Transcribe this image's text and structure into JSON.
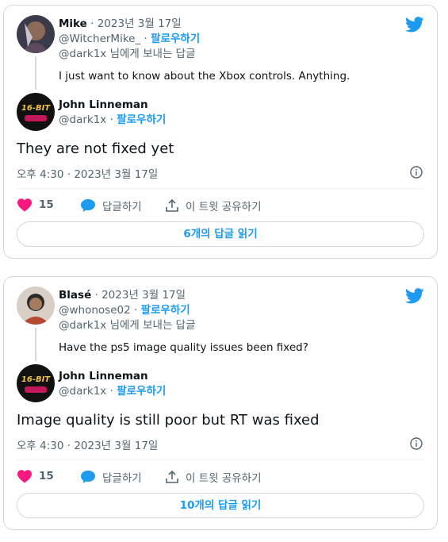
{
  "tweets": [
    {
      "parent": {
        "name": "Mike",
        "date": "· 2023년 3월 17일",
        "handle": "@WitcherMike_",
        "dot": "·",
        "follow": "팔로우하기",
        "reply_to": "@dark1x 님에게 보내는 답글",
        "text": "I just want to know about the Xbox controls. Anything."
      },
      "reply": {
        "name": "John Linneman",
        "handle": "@dark1x",
        "dot": "·",
        "follow": "팔로우하기",
        "avatar_text": "16-BIT",
        "text": "They are not fixed yet",
        "time": "오후 4:30 · 2023년 3월 17일"
      },
      "likes": "15",
      "reply_label": "답글하기",
      "share_label": "이 트윗 공유하기",
      "read_replies": "6개의 답글 읽기"
    },
    {
      "parent": {
        "name": "Blasé",
        "date": "· 2023년 3월 17일",
        "handle": "@whonose02",
        "dot": "·",
        "follow": "팔로우하기",
        "reply_to": "@dark1x 님에게 보내는 답글",
        "text": "Have the ps5 image quality issues been fixed?"
      },
      "reply": {
        "name": "John Linneman",
        "handle": "@dark1x",
        "dot": "·",
        "follow": "팔로우하기",
        "avatar_text": "16-BIT",
        "text": "Image quality is still poor but RT was fixed",
        "time": "오후 4:30 · 2023년 3월 17일"
      },
      "likes": "15",
      "reply_label": "답글하기",
      "share_label": "이 트윗 공유하기",
      "read_replies": "10개의 답글 읽기"
    }
  ],
  "colors": {
    "accent": "#1d9bf0",
    "like": "#f91880",
    "muted": "#536471",
    "border": "#cfd9de"
  },
  "icons": [
    "twitter-bird-icon",
    "info-icon",
    "heart-icon",
    "reply-bubble-icon",
    "share-icon"
  ]
}
